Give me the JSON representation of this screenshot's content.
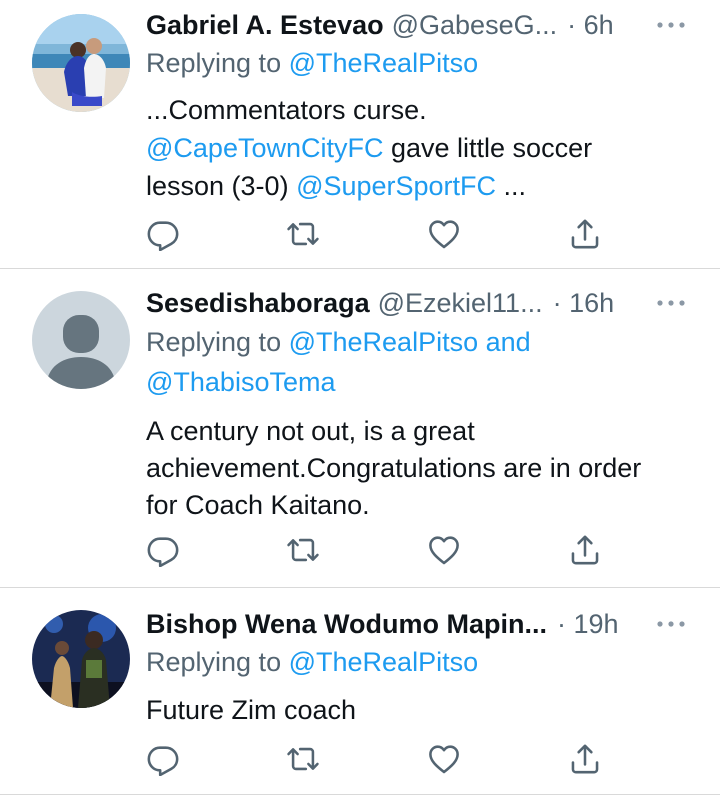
{
  "tweets": [
    {
      "name": "Gabriel A. Estevao",
      "handle": "@GabeseG...",
      "time": "· 6h",
      "replying_prefix": "Replying to",
      "replying_to": "@TheRealPitso",
      "body_line1": "...Commentators curse.",
      "body_mention1": "@CapeTownCityFC",
      "body_line2_rest": " gave little soccer",
      "body_line3_start": "lesson (3-0) ",
      "body_mention2": "@SuperSportFC",
      "body_line3_end": " ...",
      "avatar": "photo-couple-beach"
    },
    {
      "name": "Sesedishaboraga",
      "handle": "@Ezekiel11...",
      "time": "· 16h",
      "replying_prefix": "Replying to",
      "replying_to": "@TheRealPitso",
      "replying_and": " and",
      "replying_to2": "@ThabisoTema",
      "body_line1": "A century not out, is a great",
      "body_line2": "achievement.Congratulations are in order",
      "body_line3": "for Coach Kaitano.",
      "avatar": "default-avatar"
    },
    {
      "name": "Bishop Wena Wodumo Mapin...",
      "time": "· 19h",
      "replying_prefix": "Replying to",
      "replying_to": "@TheRealPitso",
      "body_line1": "Future Zim coach",
      "avatar": "photo-performers-stage"
    }
  ],
  "icons": [
    "reply-icon",
    "retweet-icon",
    "like-icon",
    "share-icon",
    "more-icon"
  ],
  "colors": {
    "link": "#1d9bf0",
    "secondary": "#536471",
    "text": "#0f1419",
    "divider": "#d9d9d9"
  }
}
